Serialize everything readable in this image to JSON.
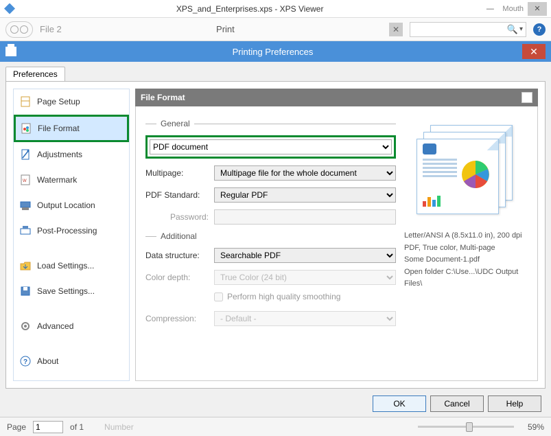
{
  "window": {
    "title": "XPS_and_Enterprises.xps - XPS Viewer",
    "mouth": "Mouth"
  },
  "printbar": {
    "file2": "File 2",
    "title": "Print"
  },
  "dialog": {
    "title": "Printing Preferences"
  },
  "tab": "Preferences",
  "sidebar": {
    "items": [
      {
        "label": "Page Setup"
      },
      {
        "label": "File Format"
      },
      {
        "label": "Adjustments"
      },
      {
        "label": "Watermark"
      },
      {
        "label": "Output Location"
      },
      {
        "label": "Post-Processing"
      },
      {
        "label": "Load Settings..."
      },
      {
        "label": "Save Settings..."
      },
      {
        "label": "Advanced"
      },
      {
        "label": "About"
      }
    ]
  },
  "content": {
    "header": "File Format",
    "general": {
      "title": "General",
      "format": "PDF document",
      "multipage_label": "Multipage:",
      "multipage": "Multipage file for the whole document",
      "pdfstd_label": "PDF Standard:",
      "pdfstd": "Regular PDF",
      "password_label": "Password:"
    },
    "additional": {
      "title": "Additional",
      "datastruct_label": "Data structure:",
      "datastruct": "Searchable PDF",
      "colordepth_label": "Color depth:",
      "colordepth": "True Color (24 bit)",
      "smoothing": "Perform high quality smoothing",
      "compression_label": "Compression:",
      "compression": "- Default -"
    },
    "preview": {
      "line1": "Letter/ANSI A (8.5x11.0 in), 200 dpi",
      "line2": "PDF, True color, Multi-page",
      "line3": "Some Document-1.pdf",
      "line4": "Open folder C:\\Use...\\UDC Output Files\\"
    }
  },
  "buttons": {
    "ok": "OK",
    "cancel": "Cancel",
    "help": "Help"
  },
  "status": {
    "page_label": "Page",
    "page": "1",
    "of": "of 1",
    "number": "Number",
    "zoom": "59%"
  }
}
